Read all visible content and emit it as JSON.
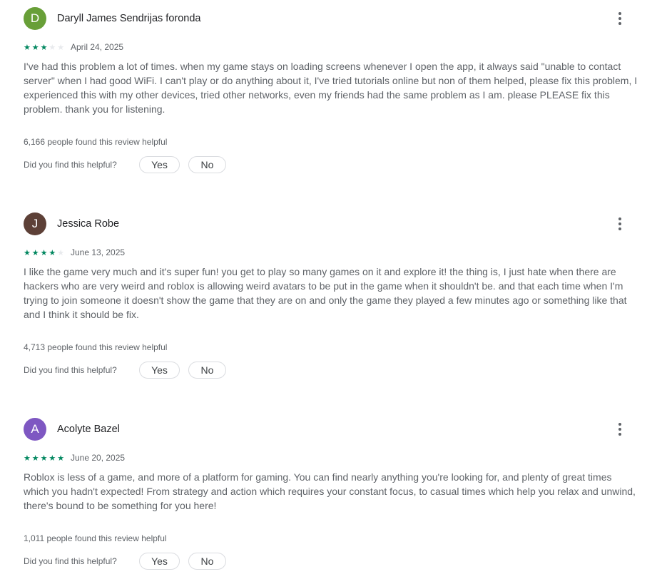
{
  "reviews": [
    {
      "avatar_letter": "D",
      "avatar_color": "#689f38",
      "author": "Daryll James Sendrijas foronda",
      "rating": 3,
      "date": "April 24, 2025",
      "body": "I've had this problem a lot of times. when my game stays on loading screens whenever I open the app, it always said \"unable to contact server\" when I had good WiFi. I can't play or do anything about it, I've tried tutorials online but non of them helped, please fix this problem, I experienced this with my other devices, tried other networks, even my friends had the same problem as I am. please PLEASE fix this problem. thank you for listening.",
      "helpful_count": "6,166 people found this review helpful"
    },
    {
      "avatar_letter": "J",
      "avatar_color": "#5d4037",
      "author": "Jessica Robe",
      "rating": 4,
      "date": "June 13, 2025",
      "body": "I like the game very much and it's super fun! you get to play so many games on it and explore it! the thing is, I just hate when there are hackers who are very weird and roblox is allowing weird avatars to be put in the game when it shouldn't be. and that each time when I'm trying to join someone it doesn't show the game that they are on and only the game they played a few minutes ago or something like that and I think it should be fix.",
      "helpful_count": "4,713 people found this review helpful"
    },
    {
      "avatar_letter": "A",
      "avatar_color": "#7e57c2",
      "author": "Acolyte Bazel",
      "rating": 5,
      "date": "June 20, 2025",
      "body": "Roblox is less of a game, and more of a platform for gaming. You can find nearly anything you're looking for, and plenty of great times which you hadn't expected! From strategy and action which requires your constant focus, to casual times which help you relax and unwind, there's bound to be something for you here!",
      "helpful_count": "1,011 people found this review helpful"
    }
  ],
  "helpful_prompt": "Did you find this helpful?",
  "yes_label": "Yes",
  "no_label": "No",
  "star_on_color": "#01875f",
  "star_off_color": "#e8eaed",
  "menu_icon": "more-vert-icon"
}
